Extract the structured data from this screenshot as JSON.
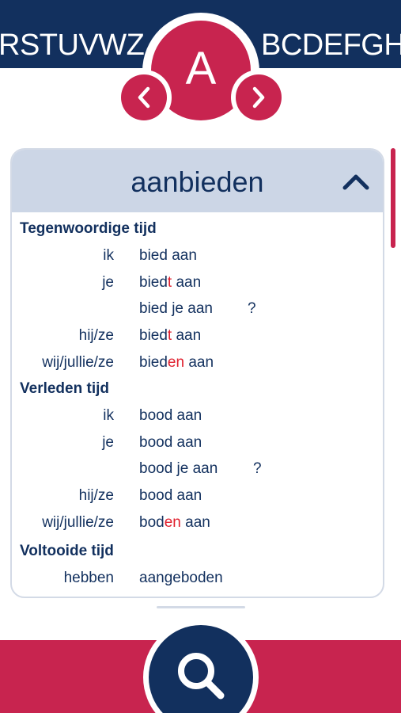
{
  "header": {
    "alphabet_left": "RSTUVWZ",
    "alphabet_right": "BCDEFGHI",
    "current_letter": "A",
    "prev_icon": "chevron-left-icon",
    "next_icon": "chevron-right-icon"
  },
  "card": {
    "verb": "aanbieden",
    "collapse_icon": "chevron-up-icon",
    "sections": {
      "present": {
        "title": "Tegenwoordige tijd",
        "rows": [
          {
            "pronoun": "ik",
            "pre": "bied",
            "hl": "",
            "post": " aan",
            "q": ""
          },
          {
            "pronoun": "je",
            "pre": "bied",
            "hl": "t",
            "post": " aan",
            "q": ""
          },
          {
            "pronoun": "",
            "pre": "bied je aan",
            "hl": "",
            "post": "",
            "q": "?"
          },
          {
            "pronoun": "hij/ze",
            "pre": "bied",
            "hl": "t",
            "post": " aan",
            "q": ""
          },
          {
            "pronoun": "wij/jullie/ze",
            "pre": "bied",
            "hl": "en",
            "post": " aan",
            "q": ""
          }
        ]
      },
      "past": {
        "title": "Verleden tijd",
        "rows": [
          {
            "pronoun": "ik",
            "pre": "bood aan",
            "hl": "",
            "post": "",
            "q": ""
          },
          {
            "pronoun": "je",
            "pre": "bood aan",
            "hl": "",
            "post": "",
            "q": ""
          },
          {
            "pronoun": "",
            "pre": "bood je aan",
            "hl": "",
            "post": "",
            "q": "?"
          },
          {
            "pronoun": "hij/ze",
            "pre": "bood aan",
            "hl": "",
            "post": "",
            "q": ""
          },
          {
            "pronoun": "wij/jullie/ze",
            "pre": "bod",
            "hl": "en",
            "post": " aan",
            "q": ""
          }
        ]
      },
      "perfect": {
        "title": "Voltooide tijd",
        "rows": [
          {
            "pronoun": "hebben",
            "pre": "aangeboden",
            "hl": "",
            "post": "",
            "q": ""
          }
        ]
      }
    }
  },
  "footer": {
    "search_icon": "search-icon"
  },
  "colors": {
    "navy": "#12305e",
    "crimson": "#c8244f",
    "highlight": "#e0202e",
    "header_bg": "#ccd6e6"
  }
}
